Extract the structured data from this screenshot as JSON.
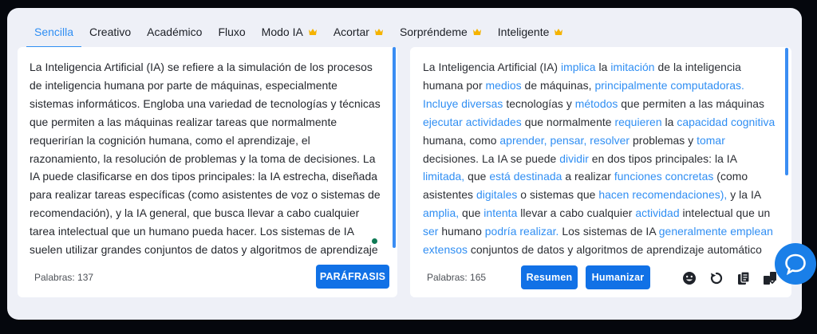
{
  "tabs": [
    {
      "label": "Sencilla",
      "premium": false,
      "active": true
    },
    {
      "label": "Creativo",
      "premium": false,
      "active": false
    },
    {
      "label": "Académico",
      "premium": false,
      "active": false
    },
    {
      "label": "Fluxo",
      "premium": false,
      "active": false
    },
    {
      "label": "Modo IA",
      "premium": true,
      "active": false
    },
    {
      "label": "Acortar",
      "premium": true,
      "active": false
    },
    {
      "label": "Sorpréndeme",
      "premium": true,
      "active": false
    },
    {
      "label": "Inteligente",
      "premium": true,
      "active": false
    }
  ],
  "input": {
    "text": "La Inteligencia Artificial (IA) se refiere a la simulación de los procesos de inteligencia humana por parte de máquinas, especialmente sistemas informáticos. Engloba una variedad de tecnologías y técnicas que permiten a las máquinas realizar tareas que normalmente requerirían la cognición humana, como el aprendizaje, el razonamiento, la resolución de problemas y la toma de decisiones. La IA puede clasificarse en dos tipos principales: la IA estrecha, diseñada para realizar tareas específicas (como asistentes de voz o sistemas de recomendación), y la IA general, que busca llevar a cabo cualquier tarea intelectual que un humano pueda hacer. Los sistemas de IA suelen utilizar grandes conjuntos de datos y algoritmos de aprendizaje",
    "word_count": "Palabras: 137",
    "paraphrase_button": "PARÁFRASIS"
  },
  "output": {
    "segments": [
      {
        "t": "La Inteligencia Artificial (IA) ",
        "h": false
      },
      {
        "t": "implica",
        "h": true
      },
      {
        "t": " la ",
        "h": false
      },
      {
        "t": "imitación",
        "h": true
      },
      {
        "t": " de la inteligencia humana por ",
        "h": false
      },
      {
        "t": "medios",
        "h": true
      },
      {
        "t": " de máquinas, ",
        "h": false
      },
      {
        "t": "principalmente computadoras. Incluye diversas",
        "h": true
      },
      {
        "t": " tecnologías y ",
        "h": false
      },
      {
        "t": "métodos",
        "h": true
      },
      {
        "t": " que permiten a las máquinas ",
        "h": false
      },
      {
        "t": "ejecutar actividades",
        "h": true
      },
      {
        "t": " que normalmente ",
        "h": false
      },
      {
        "t": "requieren",
        "h": true
      },
      {
        "t": " la ",
        "h": false
      },
      {
        "t": "capacidad cognitiva",
        "h": true
      },
      {
        "t": " humana, como ",
        "h": false
      },
      {
        "t": "aprender, pensar, resolver",
        "h": true
      },
      {
        "t": " problemas y ",
        "h": false
      },
      {
        "t": "tomar",
        "h": true
      },
      {
        "t": " decisiones. La IA se puede ",
        "h": false
      },
      {
        "t": "dividir",
        "h": true
      },
      {
        "t": " en dos tipos principales: la IA ",
        "h": false
      },
      {
        "t": "limitada,",
        "h": true
      },
      {
        "t": " que ",
        "h": false
      },
      {
        "t": "está destinada",
        "h": true
      },
      {
        "t": " a realizar ",
        "h": false
      },
      {
        "t": "funciones concretas",
        "h": true
      },
      {
        "t": " (como asistentes ",
        "h": false
      },
      {
        "t": "digitales",
        "h": true
      },
      {
        "t": " o sistemas que ",
        "h": false
      },
      {
        "t": "hacen recomendaciones),",
        "h": true
      },
      {
        "t": " y la IA ",
        "h": false
      },
      {
        "t": "amplia,",
        "h": true
      },
      {
        "t": " que ",
        "h": false
      },
      {
        "t": "intenta",
        "h": true
      },
      {
        "t": " llevar a cabo cualquier ",
        "h": false
      },
      {
        "t": "actividad",
        "h": true
      },
      {
        "t": " intelectual que un ",
        "h": false
      },
      {
        "t": "ser",
        "h": true
      },
      {
        "t": " humano ",
        "h": false
      },
      {
        "t": "podría realizar.",
        "h": true
      },
      {
        "t": " Los sistemas de IA ",
        "h": false
      },
      {
        "t": "generalmente emplean extensos",
        "h": true
      },
      {
        "t": " conjuntos de datos y algoritmos de aprendizaje automático",
        "h": false
      }
    ],
    "word_count": "Palabras: 165",
    "summary_button": "Resumen",
    "humanize_button": "Humanizar",
    "tool_icons": [
      "emoji-icon",
      "undo-icon",
      "copy-icon",
      "compare-icon"
    ]
  },
  "colors": {
    "accent": "#2f8ef3",
    "button": "#1171e6",
    "crown": "#f5b301",
    "background": "#eef0f7"
  }
}
